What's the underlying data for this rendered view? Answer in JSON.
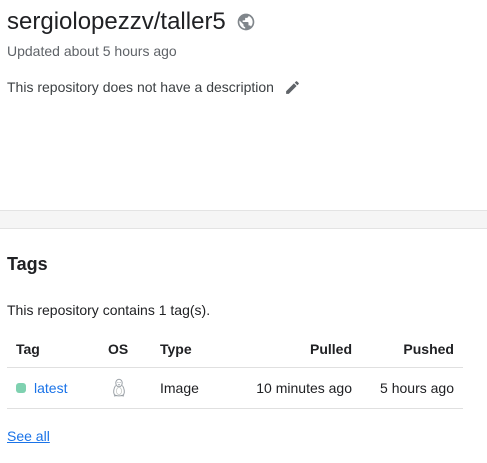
{
  "repository": {
    "name": "sergiolopezzv/taller5",
    "visibility_icon": "globe-icon",
    "updated": "Updated about 5 hours ago",
    "description": "This repository does not have a description",
    "edit_icon": "pencil-icon"
  },
  "tags_section": {
    "heading": "Tags",
    "count_text": "This repository contains 1 tag(s).",
    "columns": {
      "tag": "Tag",
      "os": "OS",
      "type": "Type",
      "pulled": "Pulled",
      "pushed": "Pushed"
    },
    "rows": [
      {
        "tag": "latest",
        "status_color": "#7fd1b0",
        "os_icon": "linux-penguin-icon",
        "type": "Image",
        "pulled": "10 minutes ago",
        "pushed": "5 hours ago"
      }
    ],
    "see_all": "See all"
  },
  "colors": {
    "link": "#1a73e8",
    "muted_text": "#5f6368",
    "band": "#f5f5f5"
  }
}
